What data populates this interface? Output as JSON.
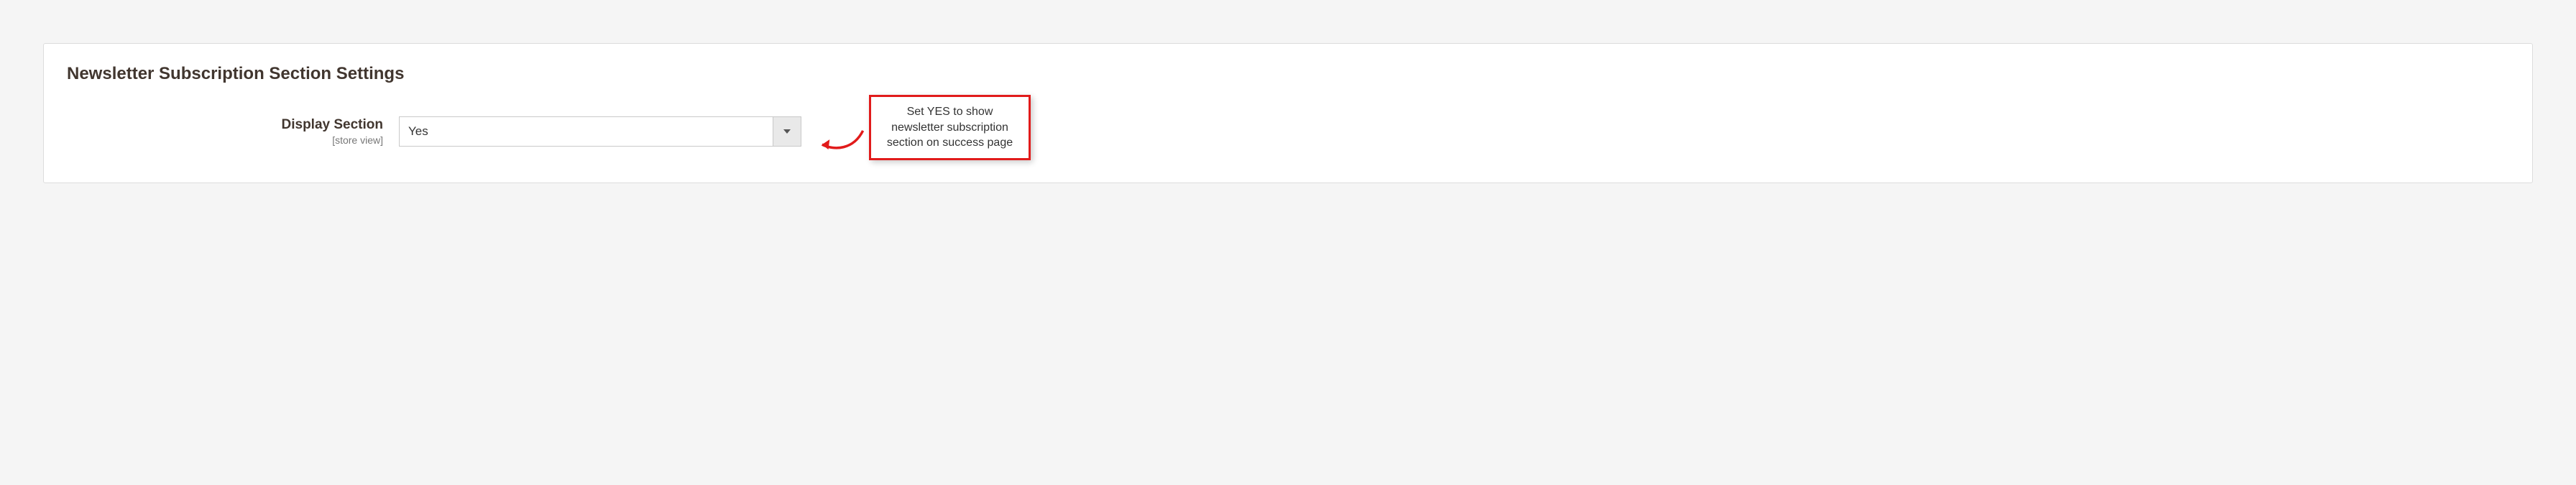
{
  "panel": {
    "title": "Newsletter Subscription Section Settings"
  },
  "field": {
    "label": "Display Section",
    "scope": "[store view]",
    "value": "Yes"
  },
  "annotation": {
    "text": "Set YES to show newsletter subscription section on success page"
  }
}
